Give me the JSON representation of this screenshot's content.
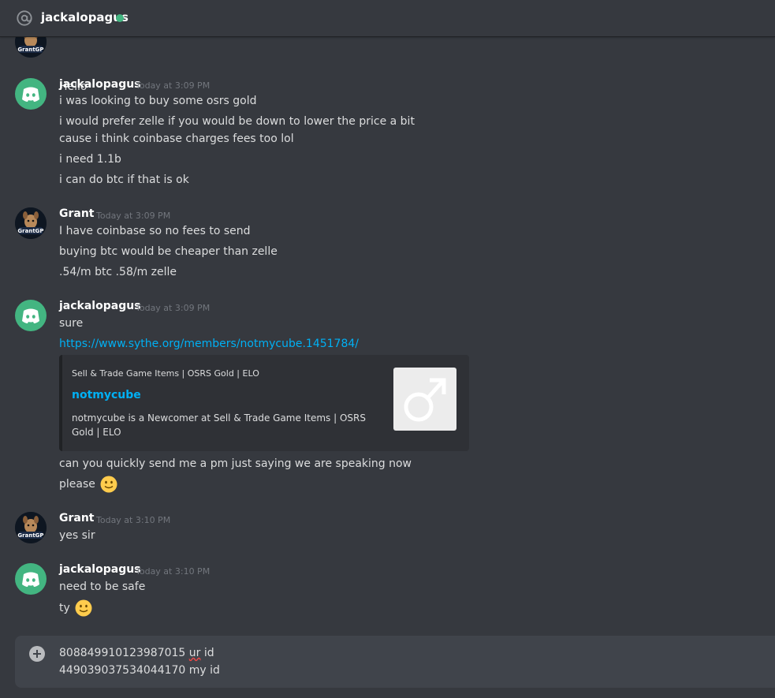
{
  "header": {
    "title": "jackalopagus",
    "status_color": "#43b581"
  },
  "users": {
    "jack": {
      "name": "jackalopagus",
      "avatar": "discord-logo",
      "color": "#43b581"
    },
    "grant": {
      "name": "Grant",
      "avatar": "GrantGP"
    }
  },
  "partial": {
    "text": "Hello"
  },
  "groups": [
    {
      "author": "jackalopagus",
      "timestamp": "Today at 3:09 PM",
      "lines": [
        "i was looking to buy some osrs gold",
        "i would prefer zelle if you would be down to lower the price a bit",
        "cause i think coinbase charges fees too lol",
        "i need 1.1b",
        "i can do btc if that is ok"
      ]
    },
    {
      "author": "Grant",
      "timestamp": "Today at 3:09 PM",
      "lines": [
        "I have coinbase so no fees to send",
        "buying btc would be cheaper than zelle",
        ".54/m btc .58/m zelle"
      ]
    },
    {
      "author": "jackalopagus",
      "timestamp": "Today at 3:09 PM",
      "lines": [
        "sure",
        "https://www.sythe.org/members/notmycube.1451784/",
        "can you quickly send me a pm just saying we are speaking now",
        "please"
      ],
      "embed": {
        "provider": "Sell & Trade Game Items | OSRS Gold | ELO",
        "title": "notmycube",
        "description": "notmycube is a Newcomer at Sell & Trade Game Items | OSRS Gold | ELO",
        "thumbnail": "male-symbol-icon"
      }
    },
    {
      "author": "Grant",
      "timestamp": "Today at 3:10 PM",
      "lines": [
        "yes sir"
      ]
    },
    {
      "author": "jackalopagus",
      "timestamp": "Today at 3:10 PM",
      "lines": [
        "need to be safe",
        "ty"
      ]
    }
  ],
  "composer": {
    "line1_number": "808849910123987015",
    "line1_word": "ur",
    "line1_rest": "id",
    "line2": "449039037534044170 my id"
  },
  "colors": {
    "link": "#00b0f4",
    "background": "#36393f"
  }
}
